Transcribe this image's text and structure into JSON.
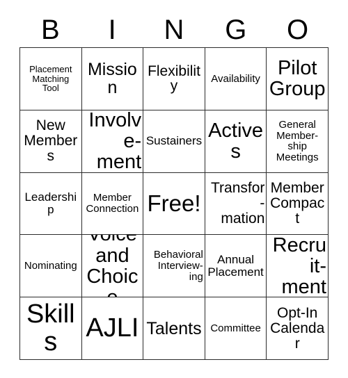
{
  "card": {
    "type": "bingo-card",
    "header_letters": [
      "B",
      "I",
      "N",
      "G",
      "O"
    ],
    "grid_size": "5x5",
    "colors": {
      "background": "#ffffff",
      "text": "#000000",
      "border": "#2b2b2b"
    },
    "rows": [
      [
        {
          "text": "Placement\nMatching\nTool",
          "size": "xs",
          "align": "center"
        },
        {
          "text": "Mission",
          "size": "xl",
          "align": "center"
        },
        {
          "text": "Flexibility",
          "size": "lg",
          "align": "center"
        },
        {
          "text": "Availability",
          "size": "sm",
          "align": "center"
        },
        {
          "text": "Pilot\nGroup",
          "size": "xxl",
          "align": "center"
        }
      ],
      [
        {
          "text": "New\nMembers",
          "size": "lg",
          "align": "center"
        },
        {
          "text": "Involve-\nment",
          "size": "xxl",
          "align": "right"
        },
        {
          "text": "Sustainers",
          "size": "md",
          "align": "center"
        },
        {
          "text": "Actives",
          "size": "xxl",
          "align": "center"
        },
        {
          "text": "General\nMember-\nship\nMeetings",
          "size": "sm",
          "align": "center"
        }
      ],
      [
        {
          "text": "Leadership",
          "size": "md",
          "align": "center"
        },
        {
          "text": "Member\nConnection",
          "size": "sm",
          "align": "center"
        },
        {
          "text": "Free!",
          "size": "free",
          "align": "center"
        },
        {
          "text": "Transfor-\nmation",
          "size": "lg",
          "align": "right"
        },
        {
          "text": "Member\nCompact",
          "size": "lg",
          "align": "center"
        }
      ],
      [
        {
          "text": "Nominating",
          "size": "sm",
          "align": "center"
        },
        {
          "text": "Voice\nand\nChoice",
          "size": "xxl",
          "align": "center"
        },
        {
          "text": "Behavioral\nInterview-\ning",
          "size": "sm",
          "align": "right"
        },
        {
          "text": "Annual\nPlacement",
          "size": "md",
          "align": "center"
        },
        {
          "text": "Recruit-\nment",
          "size": "xxl",
          "align": "right"
        }
      ],
      [
        {
          "text": "Skills",
          "size": "huge",
          "align": "center"
        },
        {
          "text": "AJLI",
          "size": "huge",
          "align": "center"
        },
        {
          "text": "Talents",
          "size": "xl",
          "align": "center"
        },
        {
          "text": "Committee",
          "size": "sm",
          "align": "center"
        },
        {
          "text": "Opt-In\nCalendar",
          "size": "lg",
          "align": "center"
        }
      ]
    ]
  }
}
